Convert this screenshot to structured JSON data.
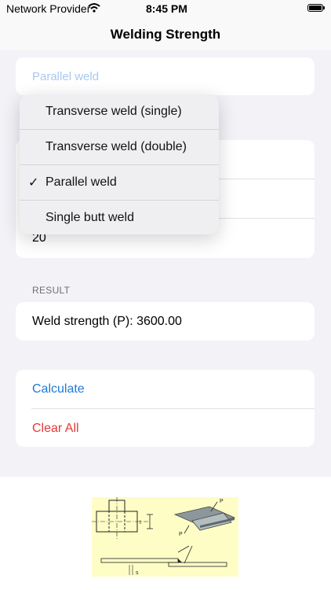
{
  "status_bar": {
    "carrier": "Network Provider",
    "time": "8:45 PM",
    "wifi_icon": "wifi-icon",
    "battery_icon": "battery-icon"
  },
  "nav": {
    "title": "Welding Strength"
  },
  "weld_type_field": {
    "placeholder": "Parallel weld"
  },
  "weld_type_menu": {
    "items": [
      {
        "label": "Transverse weld (single)",
        "selected": false
      },
      {
        "label": "Transverse weld (double)",
        "selected": false
      },
      {
        "label": "Parallel weld",
        "selected": true
      },
      {
        "label": "Single butt weld",
        "selected": false
      }
    ],
    "check_mark": "✓"
  },
  "inputs": {
    "third_value": "20"
  },
  "result": {
    "header": "RESULT",
    "text": "Weld strength (P): 3600.00"
  },
  "actions": {
    "calculate": "Calculate",
    "clear_all": "Clear All"
  },
  "diagram": {
    "labels": {
      "p_top": "P",
      "p_bottom": "P",
      "s_label": "s",
      "t_label": "t"
    }
  },
  "colors": {
    "accent": "#1e7ad6",
    "destructive": "#e53935",
    "background": "#f2f2f7",
    "diagram_bg": "#fffdc6"
  }
}
